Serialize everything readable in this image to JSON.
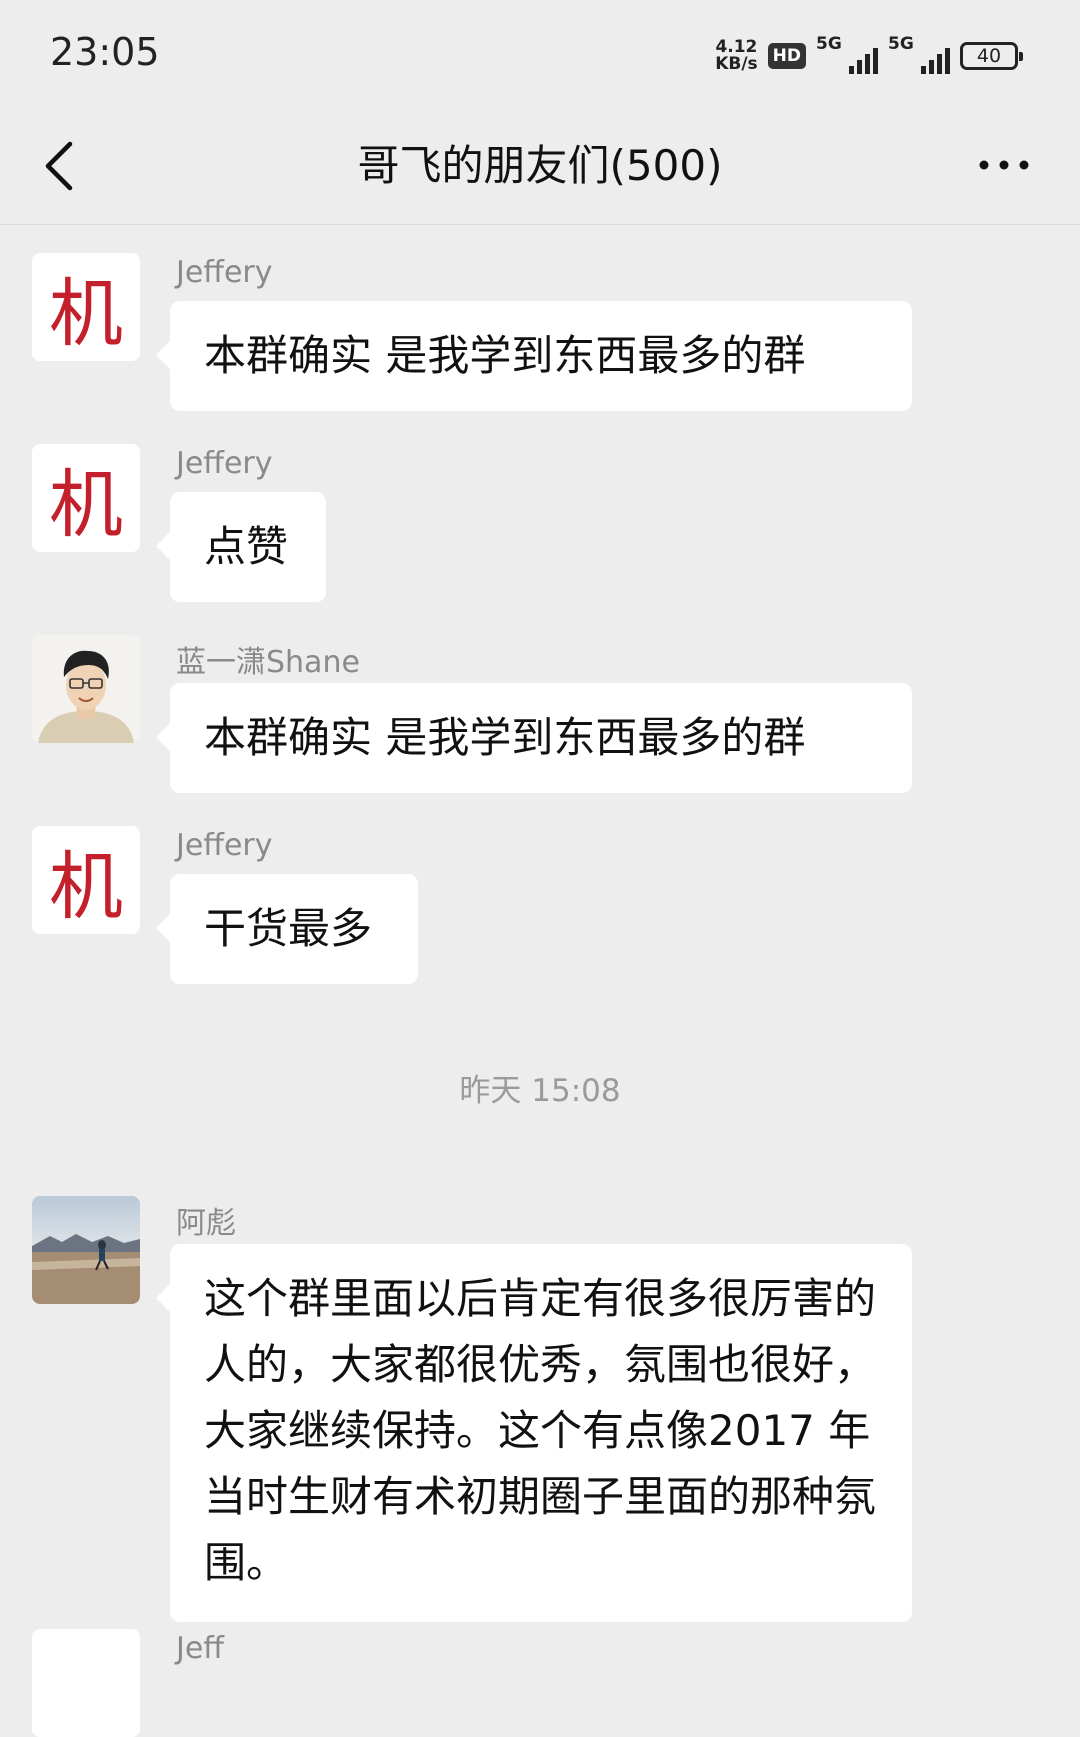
{
  "status_bar": {
    "time": "23:05",
    "net_speed_value": "4.12",
    "net_speed_unit": "KB/s",
    "hd_badge": "HD",
    "sim1_label": "5G",
    "sim2_label": "5G",
    "battery": "40"
  },
  "header": {
    "title": "哥飞的朋友们(500)"
  },
  "messages": [
    {
      "sender": "Jeffery",
      "avatar_text": "机",
      "text": "本群确实 是我学到东西最多的群"
    },
    {
      "sender": "Jeffery",
      "avatar_text": "机",
      "text": "点赞"
    },
    {
      "sender": "蓝一潇Shane",
      "avatar_text": "",
      "text": "本群确实 是我学到东西最多的群"
    },
    {
      "sender": "Jeffery",
      "avatar_text": "机",
      "text": "干货最多"
    },
    {
      "sender": "阿彪",
      "avatar_text": "",
      "text": "这个群里面以后肯定有很多很厉害的人的，大家都很优秀，氛围也很好，大家继续保持。这个有点像2017 年当时生财有术初期圈子里面的那种氛围。"
    },
    {
      "sender": "Jeff",
      "avatar_text": "",
      "text": ""
    }
  ],
  "timestamp": "昨天 15:08",
  "colors": {
    "background": "#ededed",
    "bubble": "#ffffff",
    "avatar_text": "#c3202b",
    "sender_name": "#8a8a8a"
  },
  "icons": [
    "back-chevron-icon",
    "more-dots-icon"
  ]
}
